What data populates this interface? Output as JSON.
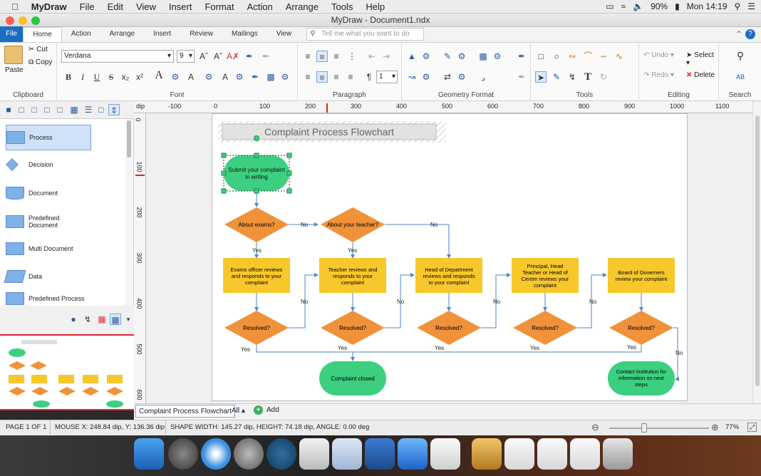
{
  "menubar": {
    "app": "MyDraw",
    "items": [
      "File",
      "Edit",
      "View",
      "Insert",
      "Format",
      "Action",
      "Arrange",
      "Tools",
      "Help"
    ],
    "battery": "90%",
    "clock": "Mon 14:19"
  },
  "window": {
    "title": "MyDraw - Document1.ndx"
  },
  "ribbon": {
    "tabs": [
      "File",
      "Home",
      "Action",
      "Arrange",
      "Insert",
      "Review",
      "Mailings",
      "View"
    ],
    "active_tab": "Home",
    "tell_placeholder": "Tell me what you want to do",
    "clipboard": {
      "label": "Clipboard",
      "paste": "Paste",
      "cut": "Cut",
      "copy": "Copy"
    },
    "font": {
      "label": "Font",
      "family": "Verdana",
      "size": "9"
    },
    "paragraph": {
      "label": "Paragraph",
      "spacing": "1"
    },
    "geometry": {
      "label": "Geometry Format"
    },
    "tools": {
      "label": "Tools"
    },
    "editing": {
      "label": "Editing",
      "undo": "Undo",
      "redo": "Redo",
      "select": "Select",
      "delete": "Delete"
    },
    "search": {
      "label": "Search"
    }
  },
  "shapes": {
    "items": [
      "Process",
      "Decision",
      "Document",
      "Predefined Document",
      "Multi Document",
      "Data",
      "Predefined Process"
    ]
  },
  "ruler": {
    "unit": "dip",
    "h_ticks": [
      "-100",
      "0",
      "100",
      "200",
      "300",
      "400",
      "500",
      "600",
      "700",
      "800",
      "900",
      "1000",
      "1100"
    ],
    "v_ticks": [
      "0",
      "100",
      "200",
      "300",
      "400",
      "500",
      "600"
    ]
  },
  "diagram": {
    "title": "Complaint Process Flowchart",
    "start": "Submit your complaint in writing",
    "q1": "About exams?",
    "q2": "About your teacher?",
    "p1": "Exams officer reviews and responds to your complaint",
    "p2": "Teacher reviews and responds to your complaint",
    "p3": "Head of Department reviews and responds to your complaint",
    "p4": "Principal, Head Teacher or Head of Centre reviews your complaint",
    "p5": "Board of Governers review your complaint",
    "resolved": "Resolved?",
    "closed": "Complaint closed",
    "contact": "Contact institution for information on next steps",
    "yes": "Yes",
    "no": "No"
  },
  "pagetabs": {
    "current": "Complaint Process Flowchart",
    "all": "All",
    "add": "Add"
  },
  "status": {
    "page": "PAGE 1 OF 1",
    "mouse": "MOUSE X: 248.84 dip, Y: 136.36 dip",
    "shape": "SHAPE WIDTH: 145.27 dip, HEIGHT: 74.18 dip, ANGLE: 0.00 deg",
    "zoom": "77%"
  },
  "colors": {
    "accent": "#1b6dc1",
    "green": "#3ccf80",
    "orange": "#f0923a",
    "yellow": "#f7c72b",
    "arrow": "#4a87c8"
  }
}
